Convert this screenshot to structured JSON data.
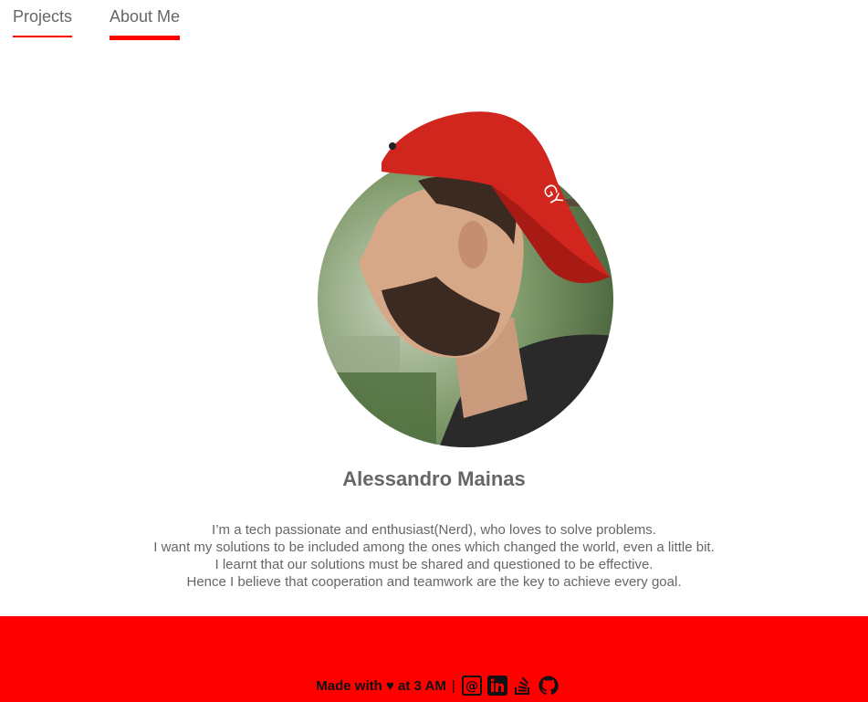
{
  "nav": {
    "tabs": [
      {
        "label": "Projects"
      },
      {
        "label": "About Me"
      }
    ],
    "active_tab": "About Me"
  },
  "profile": {
    "name": "Alessandro Mainas",
    "bio": [
      "I’m a tech passionate and enthusiast(Nerd), who loves to solve problems.",
      "I want my solutions to be included among the ones which changed the world, even a little bit.",
      "I learnt that our solutions must be shared and questioned to be effective.",
      "Hence I believe that cooperation and teamwork are the key to achieve every goal."
    ]
  },
  "footer": {
    "made_with": "Made with ♥ at 3 AM",
    "separator": "|",
    "icons": [
      "email-icon",
      "linkedin-icon",
      "stackoverflow-icon",
      "github-icon"
    ]
  },
  "colors": {
    "accent": "#ff0000",
    "text": "#666666",
    "footer_text": "#111111"
  }
}
